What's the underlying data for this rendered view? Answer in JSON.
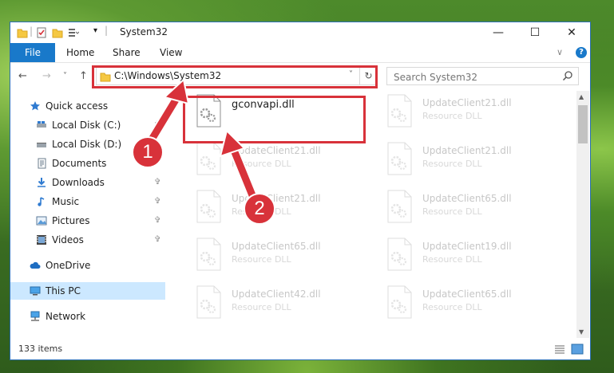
{
  "window": {
    "title": "System32",
    "minimize": "—",
    "maximize": "☐",
    "close": "✕"
  },
  "ribbon": {
    "file": "File",
    "home": "Home",
    "share": "Share",
    "view": "View",
    "help": "?"
  },
  "nav": {
    "back": "←",
    "forward": "→",
    "recent": "˅",
    "up": "↑",
    "address": "C:\\Windows\\System32",
    "address_dropdown": "˅",
    "refresh": "↻",
    "search_placeholder": "Search System32"
  },
  "sidebar": {
    "items": [
      {
        "label": "Quick access",
        "icon": "star-icon"
      },
      {
        "label": "Local Disk (C:)",
        "icon": "drive-icon"
      },
      {
        "label": "Local Disk (D:)",
        "icon": "drive-icon"
      },
      {
        "label": "Documents",
        "icon": "documents-icon"
      },
      {
        "label": "Downloads",
        "icon": "download-icon"
      },
      {
        "label": "Music",
        "icon": "music-icon"
      },
      {
        "label": "Pictures",
        "icon": "pictures-icon"
      },
      {
        "label": "Videos",
        "icon": "videos-icon"
      },
      {
        "label": "OneDrive",
        "icon": "cloud-icon"
      },
      {
        "label": "This PC",
        "icon": "computer-icon"
      },
      {
        "label": "Network",
        "icon": "network-icon"
      }
    ]
  },
  "files": [
    {
      "name": "gconvapi.dll",
      "type": ""
    },
    {
      "name": "UpdateClient21.dll",
      "type": "Resource DLL"
    },
    {
      "name": "UpdateClient21.dll",
      "type": "Resource DLL"
    },
    {
      "name": "UpdateClient21.dll",
      "type": "Resource DLL"
    },
    {
      "name": "UpdateClient21.dll",
      "type": "Resource DLL"
    },
    {
      "name": "UpdateClient65.dll",
      "type": "Resource DLL"
    },
    {
      "name": "UpdateClient65.dll",
      "type": "Resource DLL"
    },
    {
      "name": "UpdateClient19.dll",
      "type": "Resource DLL"
    },
    {
      "name": "UpdateClient42.dll",
      "type": "Resource DLL"
    },
    {
      "name": "UpdateClient65.dll",
      "type": "Resource DLL"
    }
  ],
  "status": {
    "item_count": "133 items"
  },
  "annotations": {
    "step1": "1",
    "step2": "2"
  },
  "colors": {
    "accent": "#1979ca",
    "annotation": "#d8323a",
    "selection": "#cce8ff"
  }
}
